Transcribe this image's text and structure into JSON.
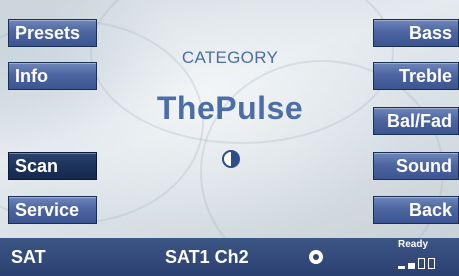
{
  "left_buttons": [
    {
      "label": "Presets",
      "active": false
    },
    {
      "label": "Info",
      "active": false
    },
    {
      "label": "Scan",
      "active": true
    },
    {
      "label": "Service",
      "active": false
    }
  ],
  "right_buttons": [
    {
      "label": "Bass"
    },
    {
      "label": "Treble"
    },
    {
      "label": "Bal/Fad"
    },
    {
      "label": "Sound"
    },
    {
      "label": "Back"
    }
  ],
  "main": {
    "category_label": "CATEGORY",
    "channel_name": "ThePulse",
    "display_icon": "contrast-half-circle-icon"
  },
  "status_bar": {
    "source": "SAT",
    "channel": "SAT1 Ch2",
    "disc_icon": "disc-icon",
    "ready_label": "Ready",
    "signal_strength_bars": 2,
    "signal_total_bars": 4
  },
  "colors": {
    "button_blue": "#4d66a2",
    "button_active": "#1c3058",
    "text_blue": "#4c6ea8",
    "status_bar": "#2a4070"
  }
}
